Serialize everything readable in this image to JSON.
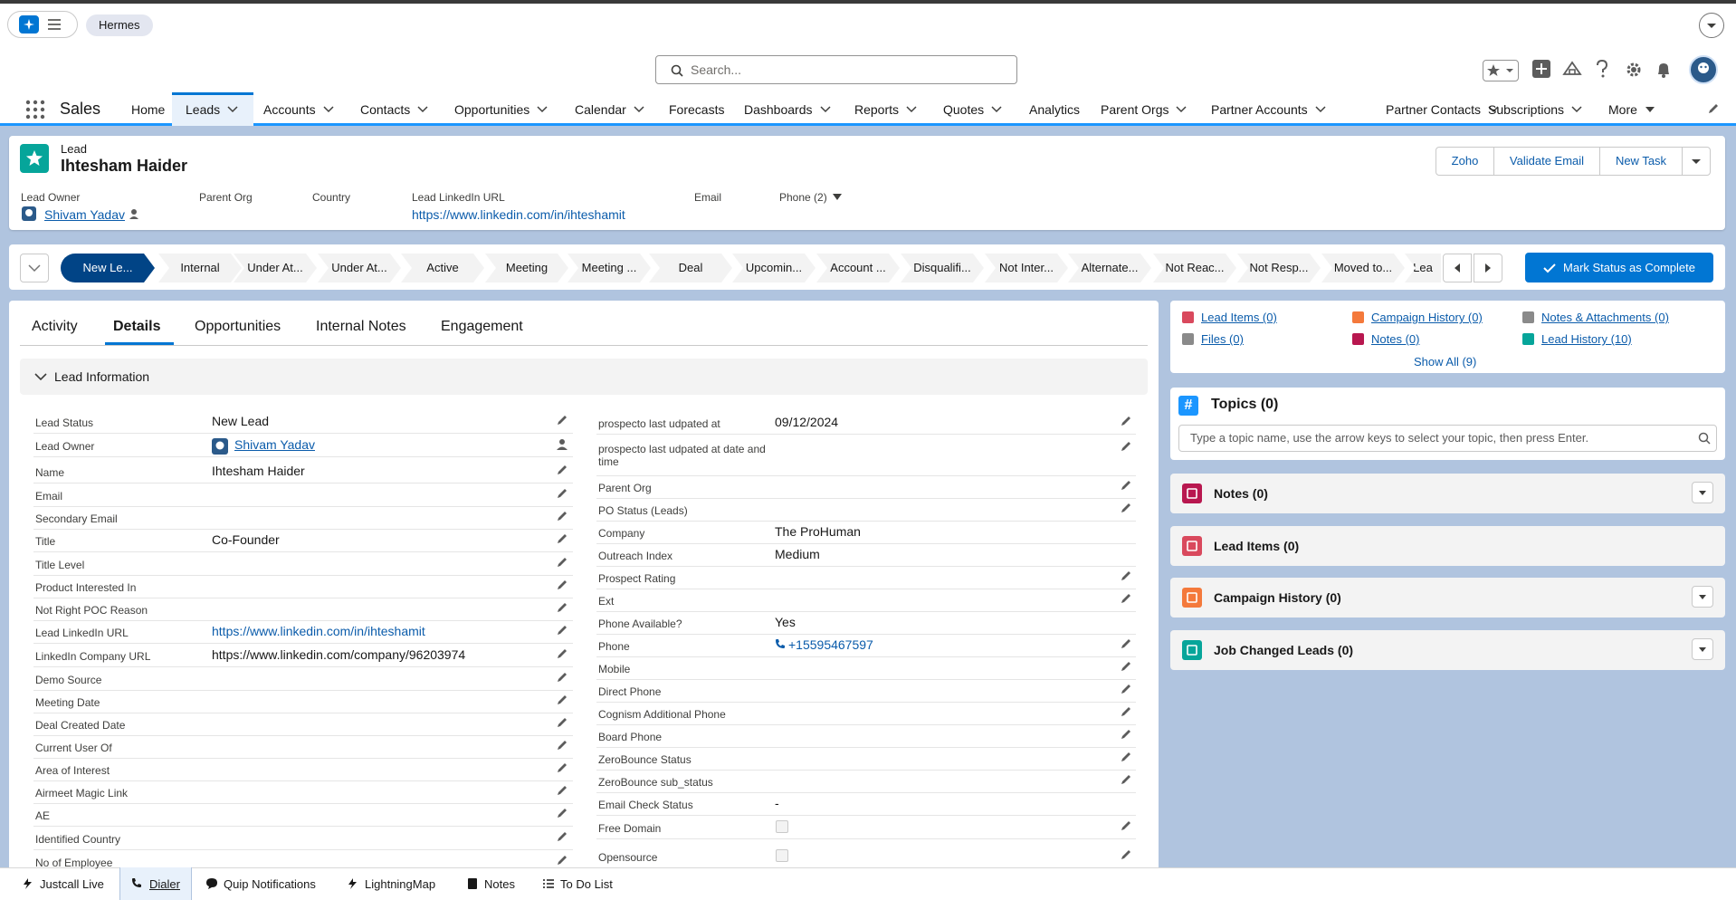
{
  "top": {
    "pill": "Hermes"
  },
  "search": {
    "placeholder": "Search..."
  },
  "app": {
    "name": "Sales"
  },
  "nav": [
    {
      "label": "Home",
      "chevron": false
    },
    {
      "label": "Leads",
      "chevron": true
    },
    {
      "label": "Accounts",
      "chevron": true
    },
    {
      "label": "Contacts",
      "chevron": true
    },
    {
      "label": "Opportunities",
      "chevron": true
    },
    {
      "label": "Calendar",
      "chevron": true
    },
    {
      "label": "Forecasts",
      "chevron": false
    },
    {
      "label": "Dashboards",
      "chevron": true
    },
    {
      "label": "Reports",
      "chevron": true
    },
    {
      "label": "Quotes",
      "chevron": true
    },
    {
      "label": "Analytics",
      "chevron": false
    },
    {
      "label": "Parent Orgs",
      "chevron": true
    },
    {
      "label": "Partner Accounts",
      "chevron": true
    },
    {
      "label": "Partner Contacts",
      "chevron": true
    },
    {
      "label": "Subscriptions",
      "chevron": true
    },
    {
      "label": "More",
      "chevron": true
    }
  ],
  "record": {
    "type": "Lead",
    "name": "Ihtesham Haider",
    "buttons": [
      "Zoho",
      "Validate Email",
      "New Task"
    ],
    "highlights": {
      "owner_label": "Lead Owner",
      "owner_value": "Shivam Yadav",
      "parent_org_label": "Parent Org",
      "country_label": "Country",
      "linkedin_label": "Lead LinkedIn URL",
      "linkedin_value": "https://www.linkedin.com/in/ihteshamit",
      "email_label": "Email",
      "phone_label": "Phone (2)"
    }
  },
  "path": {
    "stages": [
      "New Le...",
      "Internal",
      "Under At...",
      "Under At...",
      "Active",
      "Meeting",
      "Meeting ...",
      "Deal",
      "Upcomin...",
      "Account ...",
      "Disqualifi...",
      "Not Inter...",
      "Alternate...",
      "Not Reac...",
      "Not Resp...",
      "Moved to...",
      "Lea"
    ],
    "active": 0,
    "complete_button": "Mark Status as Complete"
  },
  "tabs": [
    "Activity",
    "Details",
    "Opportunities",
    "Internal Notes",
    "Engagement"
  ],
  "active_tab": 1,
  "section_title": "Lead Information",
  "left_fields": [
    {
      "label": "Lead Status",
      "value": "New Lead"
    },
    {
      "label": "Lead Owner",
      "value": "Shivam Yadav"
    },
    {
      "label": "Name",
      "value": "Ihtesham Haider"
    },
    {
      "label": "Email",
      "value": ""
    },
    {
      "label": "Secondary Email",
      "value": ""
    },
    {
      "label": "Title",
      "value": "Co-Founder"
    },
    {
      "label": "Title Level",
      "value": ""
    },
    {
      "label": "Product Interested In",
      "value": ""
    },
    {
      "label": "Not Right POC Reason",
      "value": ""
    },
    {
      "label": "Lead LinkedIn URL",
      "value": "https://www.linkedin.com/in/ihteshamit"
    },
    {
      "label": "LinkedIn Company URL",
      "value": "https://www.linkedin.com/company/96203974"
    },
    {
      "label": "Demo Source",
      "value": ""
    },
    {
      "label": "Meeting Date",
      "value": ""
    },
    {
      "label": "Deal Created Date",
      "value": ""
    },
    {
      "label": "Current User Of",
      "value": ""
    },
    {
      "label": "Area of Interest",
      "value": ""
    },
    {
      "label": "Airmeet Magic Link",
      "value": ""
    },
    {
      "label": "AE",
      "value": ""
    },
    {
      "label": "Identified Country",
      "value": ""
    },
    {
      "label": "No of Employee",
      "value": ""
    }
  ],
  "right_fields": [
    {
      "label": "prospecto last udpated at",
      "value": "09/12/2024"
    },
    {
      "label": "prospecto last udpated at date and time",
      "value": ""
    },
    {
      "label": "Parent Org",
      "value": ""
    },
    {
      "label": "PO Status (Leads)",
      "value": ""
    },
    {
      "label": "Company",
      "value": "The ProHuman"
    },
    {
      "label": "Outreach Index",
      "value": "Medium"
    },
    {
      "label": "Prospect Rating",
      "value": ""
    },
    {
      "label": "Ext",
      "value": ""
    },
    {
      "label": "Phone Available?",
      "value": "Yes"
    },
    {
      "label": "Phone",
      "value": "+15595467597"
    },
    {
      "label": "Mobile",
      "value": ""
    },
    {
      "label": "Direct Phone",
      "value": ""
    },
    {
      "label": "Cognism Additional Phone",
      "value": ""
    },
    {
      "label": "Board Phone",
      "value": ""
    },
    {
      "label": "ZeroBounce Status",
      "value": ""
    },
    {
      "label": "ZeroBounce sub_status",
      "value": ""
    },
    {
      "label": "Email Check Status",
      "value": "-"
    },
    {
      "label": "Free Domain",
      "value": ""
    },
    {
      "label": "Opensource",
      "value": ""
    }
  ],
  "related_links": [
    {
      "label": "Lead Items (0)",
      "color": "#d9495d"
    },
    {
      "label": "Campaign History (0)",
      "color": "#f4793b"
    },
    {
      "label": "Notes & Attachments (0)",
      "color": "#8a8a8a"
    },
    {
      "label": "Files (0)",
      "color": "#8a8a8a"
    },
    {
      "label": "Notes (0)",
      "color": "#b8174f"
    },
    {
      "label": "Lead History (10)",
      "color": "#06a59a"
    }
  ],
  "show_all": "Show All (9)",
  "topics": {
    "title": "Topics (0)",
    "placeholder": "Type a topic name, use the arrow keys to select your topic, then press Enter."
  },
  "related_lists": [
    {
      "title": "Notes (0)",
      "color": "#b8174f",
      "menu": true
    },
    {
      "title": "Lead Items (0)",
      "color": "#d9495d",
      "menu": false
    },
    {
      "title": "Campaign History (0)",
      "color": "#f4793b",
      "menu": true
    },
    {
      "title": "Job Changed Leads (0)",
      "color": "#06a59a",
      "menu": true
    }
  ],
  "utility": [
    "Justcall Live",
    "Dialer",
    "Quip Notifications",
    "LightningMap",
    "Notes",
    "To Do List"
  ]
}
